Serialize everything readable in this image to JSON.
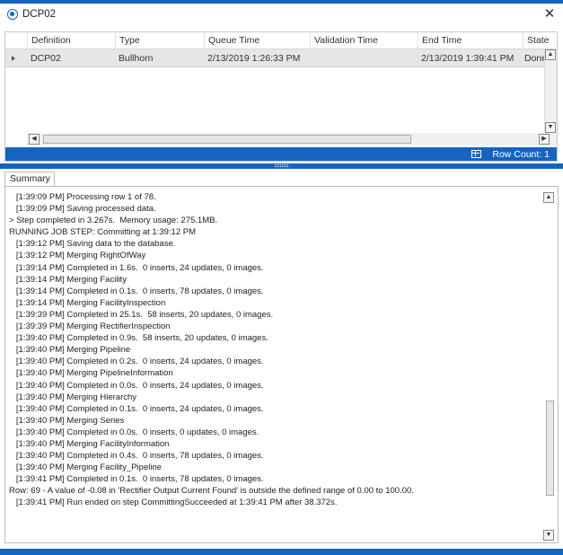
{
  "window": {
    "title": "DCP02",
    "close_glyph": "✕",
    "accent_color": "#1565c0"
  },
  "grid": {
    "columns": [
      "Definition",
      "Type",
      "Queue Time",
      "Validation Time",
      "End Time",
      "State"
    ],
    "row": {
      "definition": "DCP02",
      "type": "Bullhorn",
      "queue_time": "2/13/2019 1:26:33 PM",
      "validation_time": "",
      "end_time": "2/13/2019 1:39:41 PM",
      "state": "Done"
    },
    "row_count_label": "Row Count: 1"
  },
  "tabs": {
    "summary": "Summary"
  },
  "log_lines": [
    "   [1:39:09 PM] Processing row 1 of 78.",
    "   [1:39:09 PM] Saving processed data.",
    "> Step completed in 3.267s.  Memory usage: 275.1MB.",
    "RUNNING JOB STEP: Committing at 1:39:12 PM",
    "   [1:39:12 PM] Saving data to the database.",
    "   [1:39:12 PM] Merging RightOfWay",
    "   [1:39:14 PM] Completed in 1.6s.  0 inserts, 24 updates, 0 images.",
    "   [1:39:14 PM] Merging Facility",
    "   [1:39:14 PM] Completed in 0.1s.  0 inserts, 78 updates, 0 images.",
    "   [1:39:14 PM] Merging FacilityInspection",
    "   [1:39:39 PM] Completed in 25.1s.  58 inserts, 20 updates, 0 images.",
    "   [1:39:39 PM] Merging RectifierInspection",
    "   [1:39:40 PM] Completed in 0.9s.  58 inserts, 20 updates, 0 images.",
    "   [1:39:40 PM] Merging Pipeline",
    "   [1:39:40 PM] Completed in 0.2s.  0 inserts, 24 updates, 0 images.",
    "   [1:39:40 PM] Merging PipelineInformation",
    "   [1:39:40 PM] Completed in 0.0s.  0 inserts, 24 updates, 0 images.",
    "   [1:39:40 PM] Merging Hierarchy",
    "   [1:39:40 PM] Completed in 0.1s.  0 inserts, 24 updates, 0 images.",
    "   [1:39:40 PM] Merging Series",
    "   [1:39:40 PM] Completed in 0.0s.  0 inserts, 0 updates, 0 images.",
    "   [1:39:40 PM] Merging FacilityInformation",
    "   [1:39:40 PM] Completed in 0.4s.  0 inserts, 78 updates, 0 images.",
    "   [1:39:40 PM] Merging Facility_Pipeline",
    "   [1:39:41 PM] Completed in 0.1s.  0 inserts, 78 updates, 0 images.",
    "Row: 69 - A value of -0.08 in 'Rectifier Output Current Found' is outside the defined range of 0.00 to 100.00.",
    "   [1:39:41 PM] Run ended on step CommittingSucceeded at 1:39:41 PM after 38.372s."
  ],
  "icons": {
    "title": "app-logo-icon",
    "row_indicator": "row-arrow-icon",
    "row_count": "grid-icon"
  }
}
